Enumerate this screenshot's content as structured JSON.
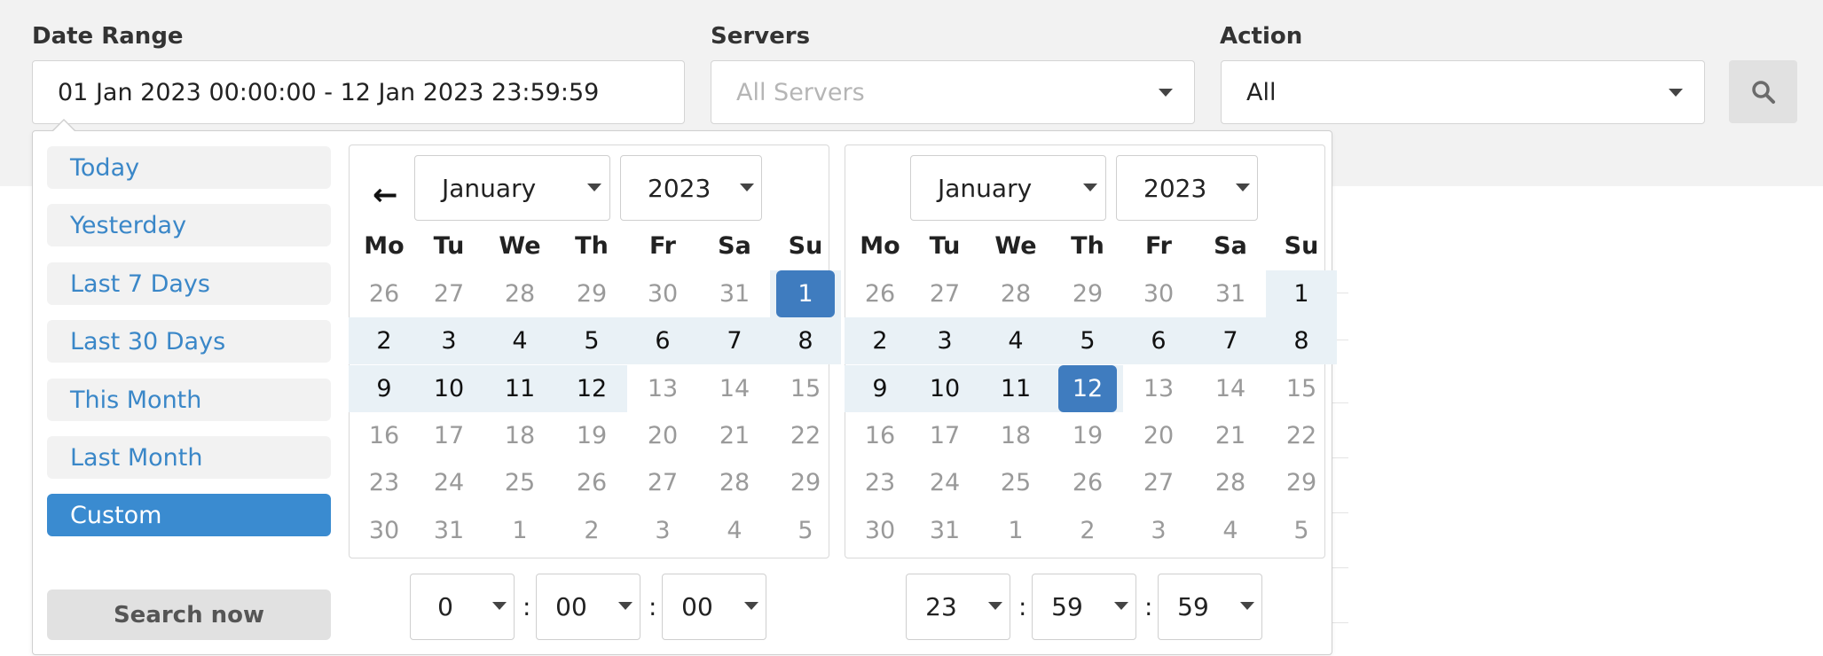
{
  "filters": {
    "date_range": {
      "label": "Date Range",
      "value": "01 Jan 2023 00:00:00 - 12 Jan 2023 23:59:59"
    },
    "servers": {
      "label": "Servers",
      "placeholder": "All Servers"
    },
    "action": {
      "label": "Action",
      "value": "All"
    },
    "search_icon": "search-icon"
  },
  "ranges": [
    "Today",
    "Yesterday",
    "Last 7 Days",
    "Last 30 Days",
    "This Month",
    "Last Month",
    "Custom"
  ],
  "active_range": "Custom",
  "search_now_label": "Search now",
  "weekdays": [
    "Mo",
    "Tu",
    "We",
    "Th",
    "Fr",
    "Sa",
    "Su"
  ],
  "calendars": [
    {
      "month": "January",
      "year": "2023",
      "has_prev": true,
      "weeks": [
        [
          "26",
          "27",
          "28",
          "29",
          "30",
          "31",
          "1"
        ],
        [
          "2",
          "3",
          "4",
          "5",
          "6",
          "7",
          "8"
        ],
        [
          "9",
          "10",
          "11",
          "12",
          "13",
          "14",
          "15"
        ],
        [
          "16",
          "17",
          "18",
          "19",
          "20",
          "21",
          "22"
        ],
        [
          "23",
          "24",
          "25",
          "26",
          "27",
          "28",
          "29"
        ],
        [
          "30",
          "31",
          "1",
          "2",
          "3",
          "4",
          "5"
        ]
      ],
      "selected_start": "1",
      "selected_end": "12",
      "time": [
        "0",
        "00",
        "00"
      ]
    },
    {
      "month": "January",
      "year": "2023",
      "has_prev": false,
      "weeks": [
        [
          "26",
          "27",
          "28",
          "29",
          "30",
          "31",
          "1"
        ],
        [
          "2",
          "3",
          "4",
          "5",
          "6",
          "7",
          "8"
        ],
        [
          "9",
          "10",
          "11",
          "12",
          "13",
          "14",
          "15"
        ],
        [
          "16",
          "17",
          "18",
          "19",
          "20",
          "21",
          "22"
        ],
        [
          "23",
          "24",
          "25",
          "26",
          "27",
          "28",
          "29"
        ],
        [
          "30",
          "31",
          "1",
          "2",
          "3",
          "4",
          "5"
        ]
      ],
      "selected_start": "1",
      "selected_end": "12",
      "time": [
        "23",
        "59",
        "59"
      ]
    }
  ],
  "colors": {
    "accent": "#3a8bd0",
    "selected_day": "#3f7cbf",
    "in_range": "#e9f1f6",
    "link": "#3a87c8"
  }
}
